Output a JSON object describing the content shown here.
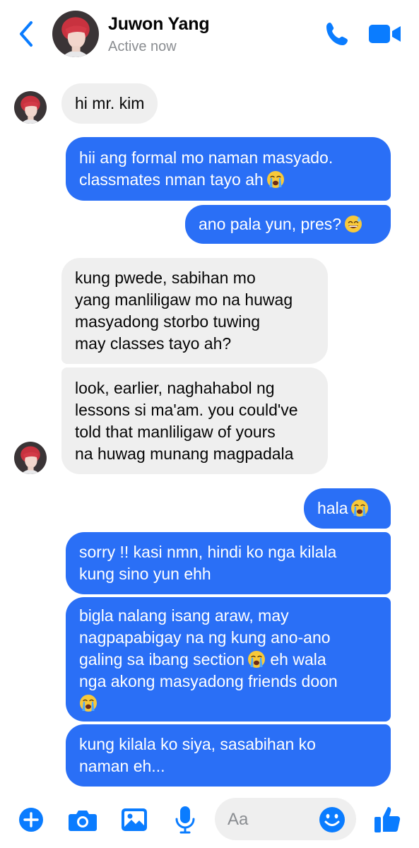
{
  "header": {
    "contact_name": "Juwon Yang",
    "status": "Active now"
  },
  "messages": [
    {
      "from": "contact",
      "text": [
        "hi mr. kim"
      ]
    },
    {
      "from": "me",
      "text": [
        "hii ang formal mo naman masyado.",
        "classmates nman tayo ah"
      ],
      "emoji": "crying"
    },
    {
      "from": "me",
      "text": [
        "ano pala yun, pres?"
      ],
      "emoji": "sweat-smile"
    },
    {
      "from": "contact",
      "text": [
        "kung pwede, sabihan mo",
        "yang manliligaw mo na huwag",
        "masyadong storbo tuwing",
        "may classes tayo ah?"
      ]
    },
    {
      "from": "contact",
      "text": [
        "look, earlier, naghahabol ng",
        "lessons si ma'am. you could've",
        "told that manliligaw of yours",
        "na huwag munang magpadala"
      ]
    },
    {
      "from": "me",
      "text": [
        "hala"
      ],
      "emoji": "crying"
    },
    {
      "from": "me",
      "text": [
        "sorry !! kasi nmn, hindi ko nga kilala",
        "kung sino yun ehh"
      ]
    },
    {
      "from": "me",
      "text": [
        "bigla nalang isang araw, may",
        "nagpapabigay na ng kung ano-ano",
        "galing sa ibang section",
        "eh wala",
        "nga akong masyadong friends doon"
      ],
      "emoji": "crying"
    },
    {
      "from": "me",
      "text": [
        "kung kilala ko siya, sasabihan ko",
        "naman eh..."
      ]
    }
  ],
  "composer": {
    "placeholder": "Aa"
  },
  "colors": {
    "accent": "#0a7cff",
    "outgoing_bubble": "#2a6ff6",
    "incoming_bubble": "#efefef"
  },
  "icons": [
    "back-chevron-icon",
    "phone-icon",
    "video-camera-icon",
    "plus-circle-icon",
    "camera-icon",
    "image-icon",
    "microphone-icon",
    "emoji-smile-icon",
    "thumbs-up-icon"
  ]
}
